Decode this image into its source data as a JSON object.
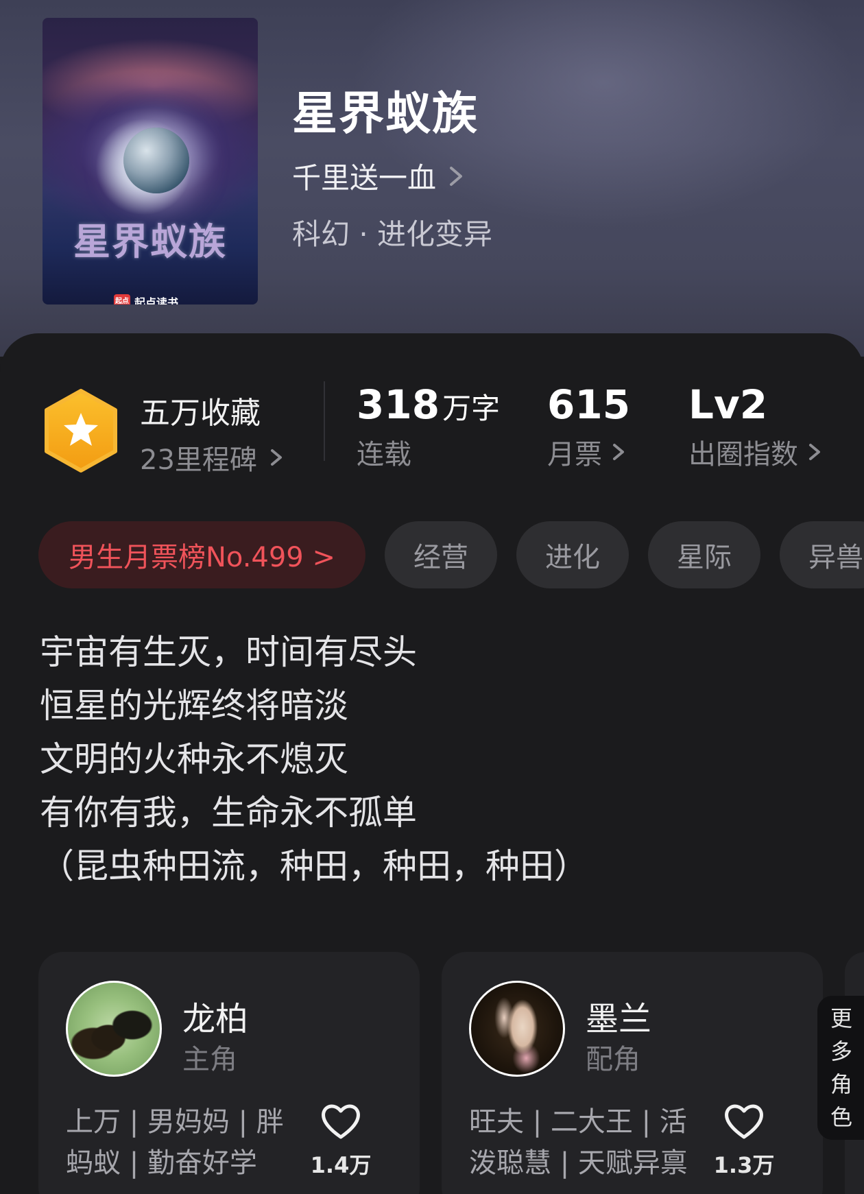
{
  "book": {
    "cover_title": "星界蚁族",
    "cover_publisher": "起点读书",
    "cover_publisher_badge": "起点",
    "title": "星界蚁族",
    "author": "千里送一血",
    "genre": "科幻 · 进化变异"
  },
  "stats": {
    "collect_title": "五万收藏",
    "collect_sub": "23里程碑",
    "words_value": "318",
    "words_unit": "万字",
    "words_label": "连载",
    "tickets_value": "615",
    "tickets_label": "月票",
    "level_value": "Lv2",
    "level_label": "出圈指数"
  },
  "tags": [
    "男生月票榜No.499 >",
    "经营",
    "进化",
    "星际",
    "异兽"
  ],
  "synopsis": [
    "宇宙有生灭，时间有尽头",
    "恒星的光辉终将暗淡",
    "文明的火种永不熄灭",
    "有你有我，生命永不孤单",
    "（昆虫种田流，种田，种田，种田）"
  ],
  "characters": [
    {
      "name": "龙柏",
      "role": "主角",
      "traits_line1": "上万 | 男妈妈 | 胖",
      "traits_line2": "蚂蚁 | 勤奋好学",
      "likes": "1.4万"
    },
    {
      "name": "墨兰",
      "role": "配角",
      "traits_line1": "旺夫 | 二大王 | 活",
      "traits_line2": "泼聪慧 | 天赋异禀",
      "likes": "1.3万"
    }
  ],
  "more_roles": [
    "更",
    "多",
    "角",
    "色"
  ],
  "colors": {
    "accent_red": "#f0535a",
    "badge_gold": "#f6a623",
    "background": "#1b1b1d"
  },
  "icons": {
    "badge": "star-hexagon-icon",
    "chevron": "chevron-right-icon",
    "like": "heart-outline-icon"
  }
}
